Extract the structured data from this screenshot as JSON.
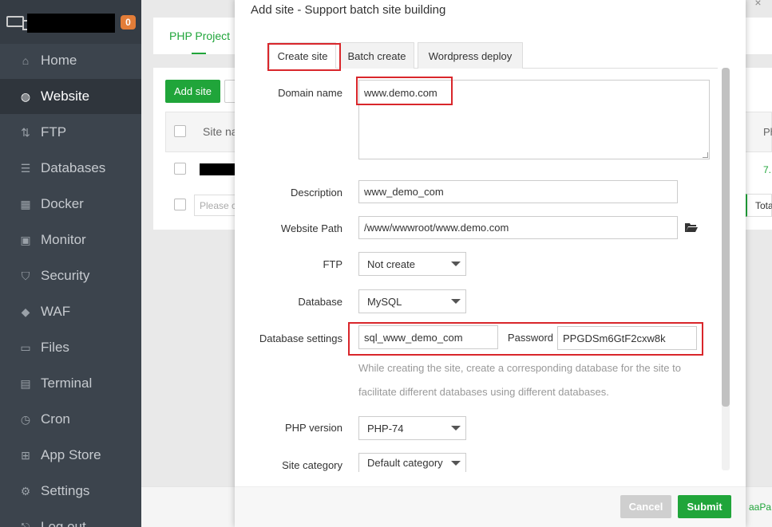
{
  "sidebar": {
    "badge": "0",
    "items": [
      {
        "label": "Home",
        "icon": "home-icon"
      },
      {
        "label": "Website",
        "icon": "globe-icon"
      },
      {
        "label": "FTP",
        "icon": "ftp-icon"
      },
      {
        "label": "Databases",
        "icon": "database-icon"
      },
      {
        "label": "Docker",
        "icon": "docker-icon"
      },
      {
        "label": "Monitor",
        "icon": "monitor-icon"
      },
      {
        "label": "Security",
        "icon": "shield-icon"
      },
      {
        "label": "WAF",
        "icon": "waf-shield-icon"
      },
      {
        "label": "Files",
        "icon": "folder-icon"
      },
      {
        "label": "Terminal",
        "icon": "terminal-icon"
      },
      {
        "label": "Cron",
        "icon": "clock-icon"
      },
      {
        "label": "App Store",
        "icon": "apps-icon"
      },
      {
        "label": "Settings",
        "icon": "gear-icon"
      },
      {
        "label": "Log out",
        "icon": "logout-icon"
      }
    ]
  },
  "background": {
    "tab_php": "PHP Project",
    "add_site": "Add site",
    "col_site": "Site na",
    "col_right": "Ph",
    "row_version": "7.",
    "search_placeholder": "Please c",
    "total": "Tota",
    "footer": "aaPa"
  },
  "modal": {
    "title": "Add site - Support batch site building",
    "tabs": [
      "Create site",
      "Batch create",
      "Wordpress deploy"
    ],
    "domain_label": "Domain name",
    "domain_value": "www.demo.com",
    "description_label": "Description",
    "description_value": "www_demo_com",
    "path_label": "Website Path",
    "path_value": "/www/wwwroot/www.demo.com",
    "ftp_label": "FTP",
    "ftp_value": "Not create",
    "database_label": "Database",
    "database_value": "MySQL",
    "db_settings_label": "Database settings",
    "db_name_value": "sql_www_demo_com",
    "password_label": "Password",
    "password_value": "PPGDSm6GtF2cxw8k",
    "hint_line1": "While creating the site, create a corresponding database for the site to",
    "hint_line2": "facilitate different databases using different databases.",
    "php_label": "PHP version",
    "php_value": "PHP-74",
    "category_label": "Site category",
    "category_value": "Default category",
    "cancel": "Cancel",
    "submit": "Submit"
  },
  "colors": {
    "accent": "#20a53a",
    "highlight": "#d9262b",
    "sidebar": "#3c444d"
  }
}
